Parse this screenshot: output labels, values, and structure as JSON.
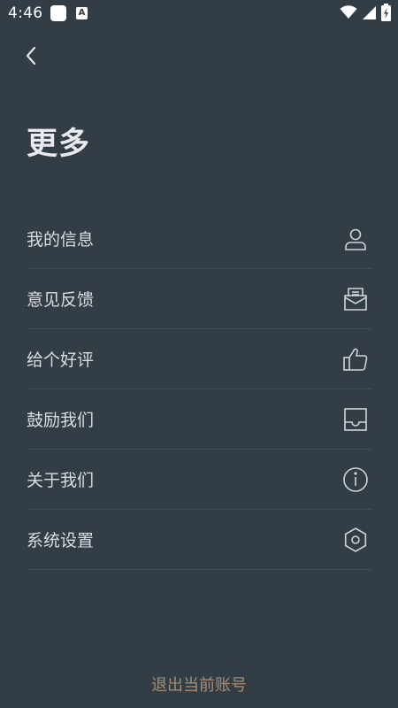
{
  "status_bar": {
    "time": "4:46",
    "notification_badge": "A",
    "icons": [
      "wifi-icon",
      "signal-icon",
      "battery-charging-icon"
    ]
  },
  "header": {
    "back_icon": "chevron-left-icon",
    "title": "更多"
  },
  "menu": {
    "items": [
      {
        "label": "我的信息",
        "icon": "user-icon"
      },
      {
        "label": "意见反馈",
        "icon": "feedback-mail-icon"
      },
      {
        "label": "给个好评",
        "icon": "thumbs-up-icon"
      },
      {
        "label": "鼓励我们",
        "icon": "inbox-icon"
      },
      {
        "label": "关于我们",
        "icon": "info-icon"
      },
      {
        "label": "系统设置",
        "icon": "settings-hexagon-icon"
      }
    ]
  },
  "footer": {
    "logout_label": "退出当前账号"
  },
  "colors": {
    "background": "#333d46",
    "divider": "#414b55",
    "text": "#d9dde1",
    "logout_text": "#a88f74"
  }
}
